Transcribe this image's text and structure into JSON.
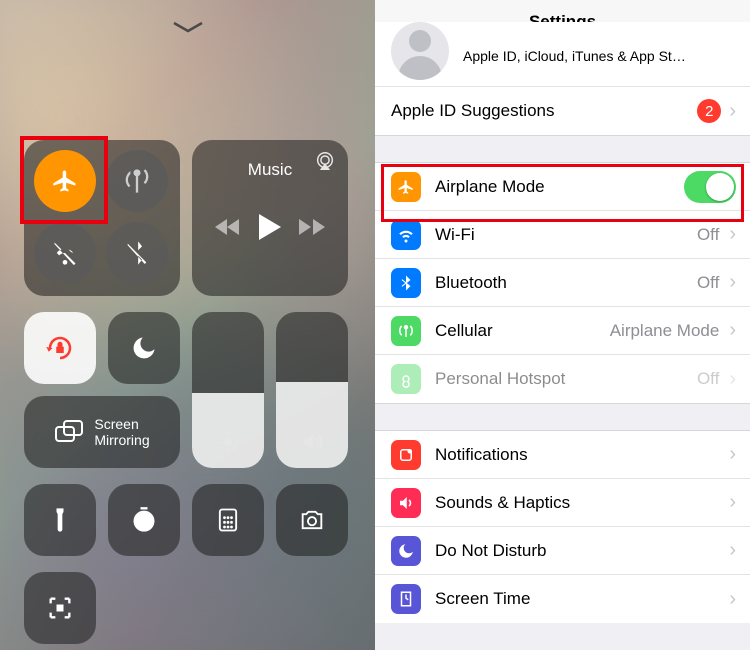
{
  "control_center": {
    "music_label": "Music",
    "screen_mirroring": "Screen\nMirroring",
    "airplane_on": true
  },
  "settings": {
    "title": "Settings",
    "apple_id_sub": "Apple ID, iCloud, iTunes & App St…",
    "suggestions": {
      "label": "Apple ID Suggestions",
      "badge": "2"
    },
    "rows": {
      "airplane": {
        "label": "Airplane Mode",
        "on": true
      },
      "wifi": {
        "label": "Wi-Fi",
        "detail": "Off"
      },
      "bluetooth": {
        "label": "Bluetooth",
        "detail": "Off"
      },
      "cellular": {
        "label": "Cellular",
        "detail": "Airplane Mode"
      },
      "hotspot": {
        "label": "Personal Hotspot",
        "detail": "Off"
      },
      "notifications": {
        "label": "Notifications"
      },
      "sounds": {
        "label": "Sounds & Haptics"
      },
      "dnd": {
        "label": "Do Not Disturb"
      },
      "screentime": {
        "label": "Screen Time"
      }
    }
  }
}
